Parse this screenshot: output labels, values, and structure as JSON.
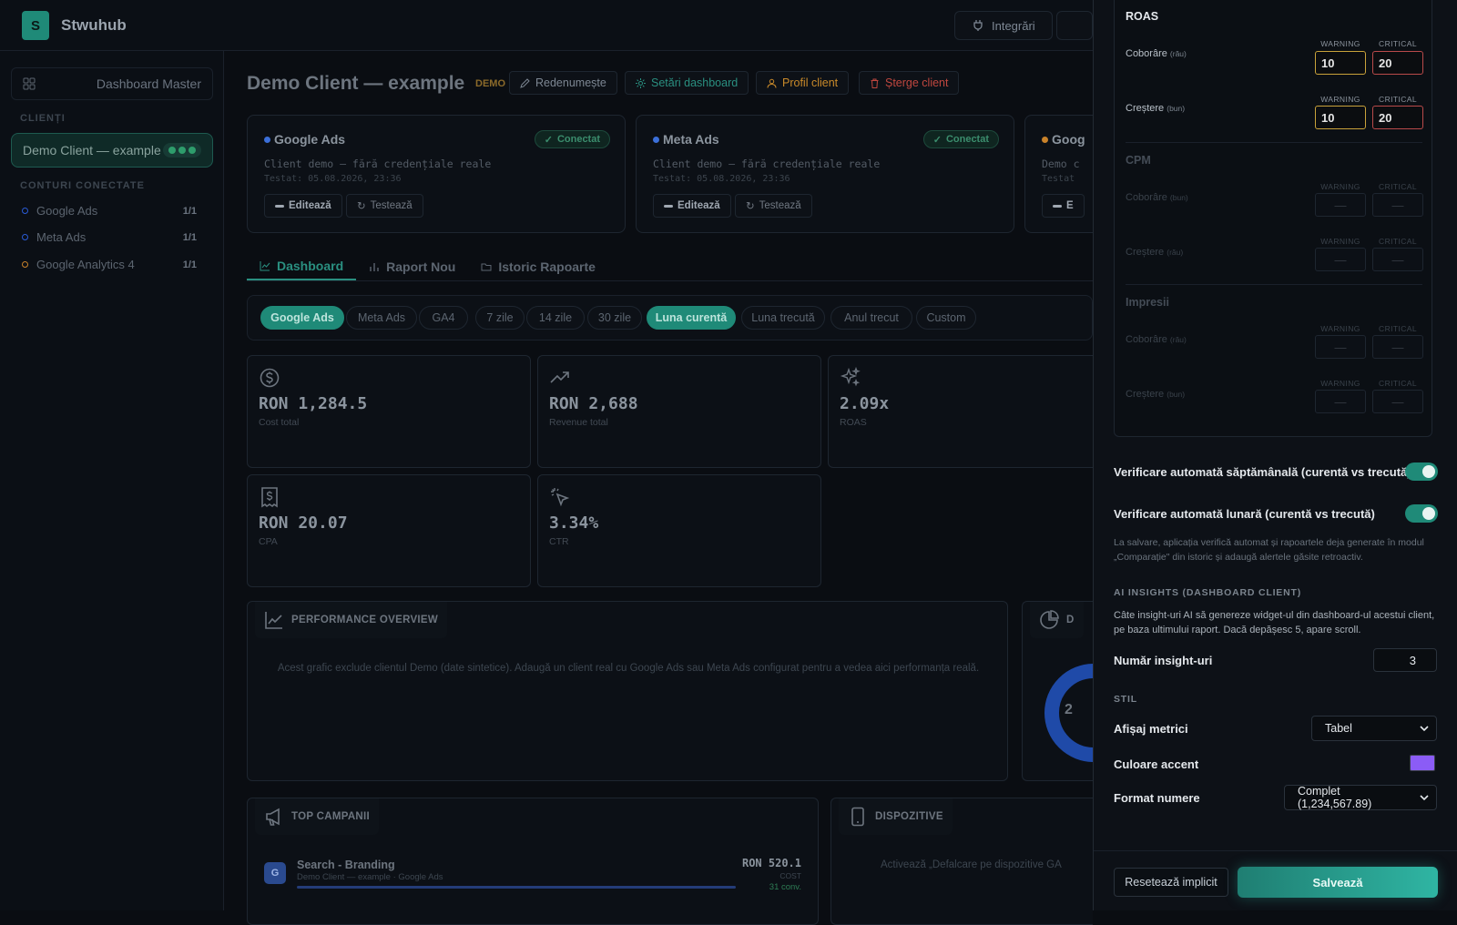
{
  "app": {
    "logo_letter": "S",
    "brand": "Stwuhub"
  },
  "topbar": {
    "integrations": "Integrări"
  },
  "sidebar": {
    "master": "Dashboard Master",
    "clients_title": "CLIENȚI",
    "active_client": "Demo Client — example",
    "accounts_title": "CONTURI CONECTATE",
    "accounts": [
      {
        "name": "Google Ads",
        "count": "1/1",
        "color": "#2a5bd7"
      },
      {
        "name": "Meta Ads",
        "count": "1/1",
        "color": "#2a5bd7"
      },
      {
        "name": "Google Analytics 4",
        "count": "1/1",
        "color": "#c9822a"
      }
    ]
  },
  "main": {
    "client_title": "Demo Client — example",
    "demo_tag": "DEMO",
    "actions": {
      "rename": "Redenumește",
      "settings": "Setări dashboard",
      "profile": "Profil client",
      "delete": "Șterge client"
    },
    "integrations": [
      {
        "name": "Google Ads",
        "status": "Conectat",
        "desc": "Client demo — fără credențiale reale",
        "tested": "Testat: 05.08.2026, 23:36",
        "edit": "Editează",
        "test": "Testează",
        "dot": "#3b6fd9"
      },
      {
        "name": "Meta Ads",
        "status": "Conectat",
        "desc": "Client demo — fără credențiale reale",
        "tested": "Testat: 05.08.2026, 23:36",
        "edit": "Editează",
        "test": "Testează",
        "dot": "#3b6fd9"
      },
      {
        "name": "Goog",
        "desc": "Demo c",
        "tested": "Testat",
        "edit": "E",
        "dot": "#c9822a"
      }
    ],
    "tabs": [
      "Dashboard",
      "Raport Nou",
      "Istoric Rapoarte"
    ],
    "filters": [
      "Google Ads",
      "Meta Ads",
      "GA4",
      "7 zile",
      "14 zile",
      "30 zile",
      "Luna curentă",
      "Luna trecută",
      "Anul trecut",
      "Custom"
    ],
    "kpis": [
      {
        "value": "RON 1,284.5",
        "label": "Cost total",
        "icon": "dollar-icon"
      },
      {
        "value": "RON 2,688",
        "label": "Revenue total",
        "icon": "trend-up-icon"
      },
      {
        "value": "2.09x",
        "label": "ROAS",
        "icon": "sparkles-icon"
      },
      {
        "value": "RON 20.07",
        "label": "CPA",
        "icon": "receipt-icon"
      },
      {
        "value": "3.34%",
        "label": "CTR",
        "icon": "cursor-click-icon"
      }
    ],
    "performance": {
      "title": "PERFORMANCE OVERVIEW",
      "note": "Acest grafic exclude clientul Demo (date sintetice). Adaugă un client real cu Google Ads sau Meta Ads configurat pentru a vedea aici performanța reală."
    },
    "donut_panel": {
      "title": "D",
      "center": "2"
    },
    "top_campaigns": {
      "title": "TOP CAMPANII",
      "rows": [
        {
          "badge": "G",
          "name": "Search - Branding",
          "sub": "Demo Client — example · Google Ads",
          "value": "RON 520.1",
          "unit": "COST",
          "conv": "31 conv."
        }
      ]
    },
    "devices": {
      "title": "DISPOZITIVE",
      "note": "Activează „Defalcare pe dispozitive GA"
    }
  },
  "drawer": {
    "thresholds": [
      {
        "group": "ROAS",
        "active": true,
        "rows": [
          {
            "label": "Coborâre",
            "hint": "(rău)",
            "warning": "10",
            "critical": "20"
          },
          {
            "label": "Creștere",
            "hint": "(bun)",
            "warning": "10",
            "critical": "20"
          }
        ]
      },
      {
        "group": "CPM",
        "active": false,
        "rows": [
          {
            "label": "Coborâre",
            "hint": "(bun)",
            "warning": "—",
            "critical": "—"
          },
          {
            "label": "Creștere",
            "hint": "(rău)",
            "warning": "—",
            "critical": "—"
          }
        ]
      },
      {
        "group": "Impresii",
        "active": false,
        "rows": [
          {
            "label": "Coborâre",
            "hint": "(rău)",
            "warning": "—",
            "critical": "—"
          },
          {
            "label": "Creștere",
            "hint": "(bun)",
            "warning": "—",
            "critical": "—"
          }
        ]
      }
    ],
    "cap_warning": "WARNING",
    "cap_critical": "CRITICAL",
    "weekly_check": "Verificare automată săptămânală (curentă vs trecută)",
    "monthly_check": "Verificare automată lunară (curentă vs trecută)",
    "save_note": "La salvare, aplicația verifică automat și rapoartele deja generate în modul „Comparație\" din istoric și adaugă alertele găsite retroactiv.",
    "ai_title": "AI INSIGHTS (DASHBOARD CLIENT)",
    "ai_note": "Câte insight-uri AI să genereze widget-ul din dashboard-ul acestui client, pe baza ultimului raport. Dacă depășesc 5, apare scroll.",
    "insights_label": "Număr insight-uri",
    "insights_value": "3",
    "style_title": "STIL",
    "metrics_label": "Afișaj metrici",
    "metrics_value": "Tabel",
    "accent_label": "Culoare accent",
    "accent_color": "#8b5cf6",
    "number_label": "Format numere",
    "number_value": "Complet (1,234,567.89)",
    "reset": "Resetează implicit",
    "save": "Salvează"
  }
}
